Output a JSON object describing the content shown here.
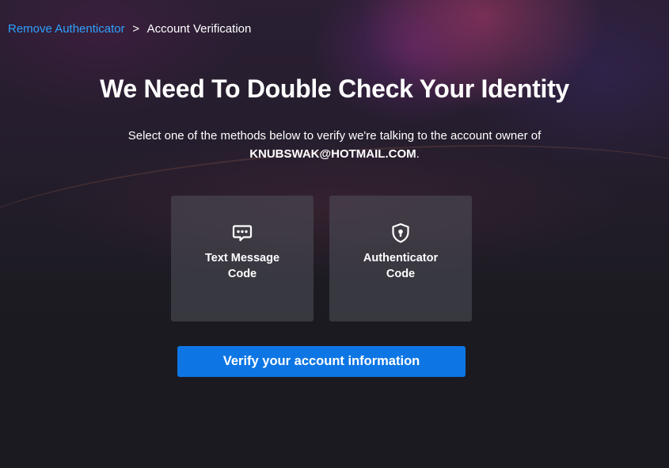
{
  "breadcrumb": {
    "parent": "Remove Authenticator",
    "separator": ">",
    "current": "Account Verification"
  },
  "heading": {
    "title": "We Need To Double Check Your Identity",
    "description": "Select one of the methods below to verify we're talking to the account owner of",
    "email": "KNUBSWAK@HOTMAIL.COM",
    "email_suffix": "."
  },
  "methods": [
    {
      "icon": "chat-bubble-icon",
      "label_line1": "Text Message",
      "label_line2": "Code"
    },
    {
      "icon": "shield-lock-icon",
      "label_line1": "Authenticator",
      "label_line2": "Code"
    }
  ],
  "actions": {
    "verify_label": "Verify your account information"
  },
  "colors": {
    "link": "#2ea1ff",
    "primary_button": "#0d76e4",
    "background": "#1c1b22",
    "card": "#44444d"
  }
}
